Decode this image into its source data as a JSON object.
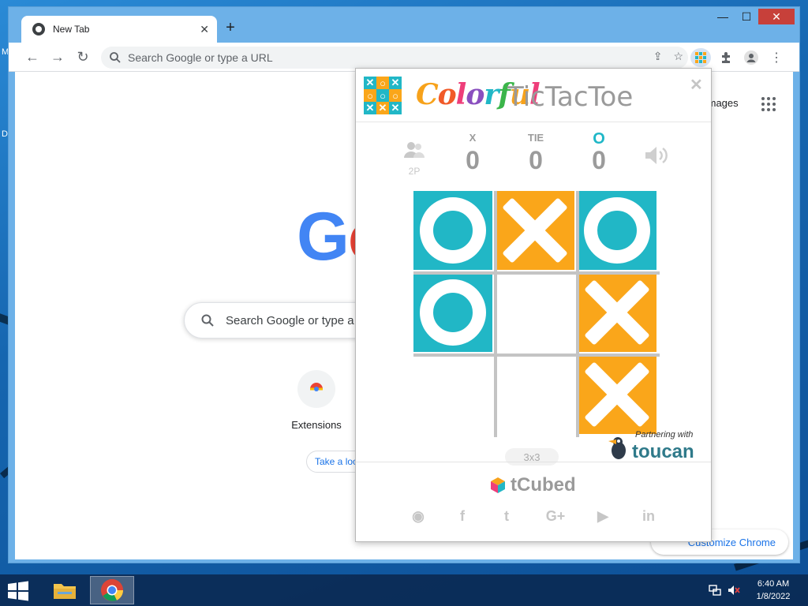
{
  "desktop": {
    "side_letters": [
      "M",
      "D"
    ]
  },
  "browser": {
    "tab_title": "New Tab",
    "new_tab_symbol": "+",
    "window_controls": {
      "minimize": "—",
      "maximize": "☐",
      "close": "✕"
    },
    "omnibox_placeholder": "Search Google or type a URL"
  },
  "newtab_page": {
    "images_link": "Images",
    "logo_visible": "Go",
    "search_placeholder": "Search Google or type a URL",
    "shortcut_label": "Extensions",
    "take_a_look": "Take a look",
    "customize": "Customize Chrome"
  },
  "extension_popup": {
    "title_colorful": [
      "C",
      "o",
      "l",
      "o",
      "r",
      "f",
      "u",
      "l"
    ],
    "title_colors": [
      "#f7a21b",
      "#f15a29",
      "#ee3e7a",
      "#8a4fbf",
      "#21b7c6",
      "#3bb54a",
      "#f7a21b",
      "#ee3e7a"
    ],
    "title_rest": "TicTacToe",
    "close": "✕",
    "mode_label": "2P",
    "scores": [
      {
        "label": "X",
        "value": "0"
      },
      {
        "label": "TIE",
        "value": "0"
      },
      {
        "label": "O",
        "value": "0"
      }
    ],
    "board": [
      [
        "O",
        "X",
        "O"
      ],
      [
        "O",
        "",
        "X"
      ],
      [
        "",
        "",
        "X"
      ]
    ],
    "board_colors": {
      "o": "#21b7c6",
      "x": "#faa61a"
    },
    "board_size": "3x3",
    "partner_text": "Partnering with",
    "partner_brand": "toucan",
    "footer_brand": "tCubed",
    "social": [
      "globe-icon",
      "facebook-icon",
      "twitter-icon",
      "google-plus-icon",
      "youtube-icon",
      "linkedin-icon"
    ],
    "social_glyphs": [
      "◉",
      "f",
      "t",
      "G+",
      "▶",
      "in"
    ]
  },
  "taskbar": {
    "time": "6:40 AM",
    "date": "1/8/2022"
  }
}
